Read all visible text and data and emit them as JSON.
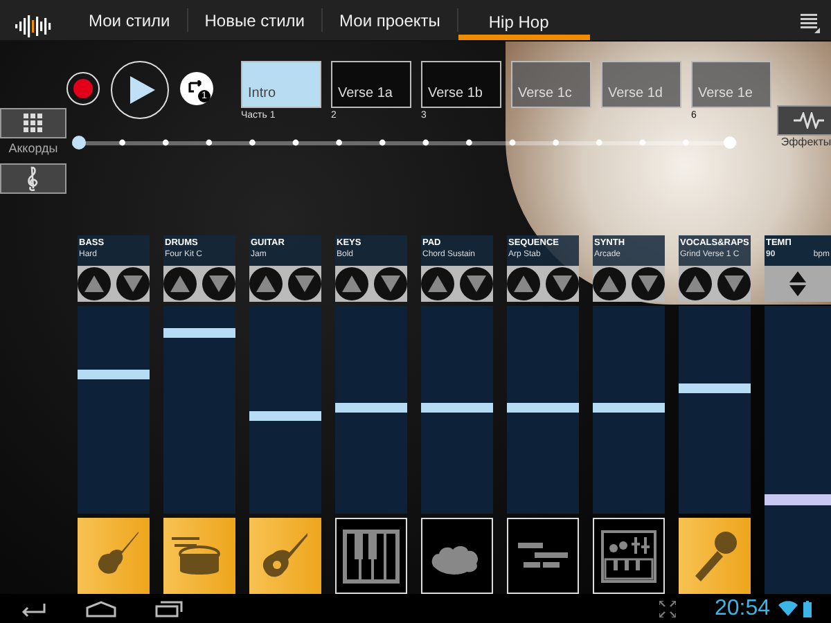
{
  "top_bar": {
    "tabs": [
      {
        "label": "Мои стили",
        "selected": false
      },
      {
        "label": "Новые стили",
        "selected": false
      },
      {
        "label": "Мои проекты",
        "selected": false
      },
      {
        "label": "Hip Hop",
        "selected": true
      }
    ]
  },
  "transport": {
    "recording": true,
    "loop_count": "1"
  },
  "parts": [
    {
      "name": "Intro",
      "number": "Часть 1",
      "selected": true,
      "faded": false
    },
    {
      "name": "Verse 1a",
      "number": "2",
      "selected": false,
      "faded": false
    },
    {
      "name": "Verse 1b",
      "number": "3",
      "selected": false,
      "faded": false
    },
    {
      "name": "Verse 1c",
      "selected": false,
      "faded": true
    },
    {
      "name": "Verse 1d",
      "selected": false,
      "faded": true
    },
    {
      "name": "Verse 1e",
      "number": "6",
      "selected": false,
      "faded": true
    }
  ],
  "left_buttons": {
    "chords_label": "Аккорды"
  },
  "right_buttons": {
    "effects_label": "Эффекты"
  },
  "timeline": {
    "level": 0
  },
  "channels": [
    {
      "kind": "electric-guitar",
      "name": "BASS",
      "preset": "Hard",
      "level": 0.68,
      "active": true
    },
    {
      "kind": "drum",
      "name": "DRUMS",
      "preset": "Four Kit C",
      "level": 0.89,
      "active": true
    },
    {
      "kind": "acoustic-guitar",
      "name": "GUITAR",
      "preset": "Jam",
      "level": 0.47,
      "active": true
    },
    {
      "kind": "piano",
      "name": "KEYS",
      "preset": "Bold",
      "level": 0.51,
      "active": false
    },
    {
      "kind": "cloud",
      "name": "PAD",
      "preset": "Chord Sustain",
      "level": 0.51,
      "active": false
    },
    {
      "kind": "sequence",
      "name": "SEQUENCE",
      "preset": "Arp Stab",
      "level": 0.51,
      "active": false
    },
    {
      "kind": "synth",
      "name": "SYNTH",
      "preset": "Arcade",
      "level": 0.51,
      "active": false
    },
    {
      "kind": "microphone",
      "name": "VOCALS&RAPS",
      "preset": "Grind Verse 1 C",
      "level": 0.61,
      "active": true
    }
  ],
  "tempo": {
    "label": "ТЕМП",
    "value": "90",
    "unit": "bpm",
    "level": 0.32
  },
  "nav_bar": {
    "time": "20:54"
  }
}
